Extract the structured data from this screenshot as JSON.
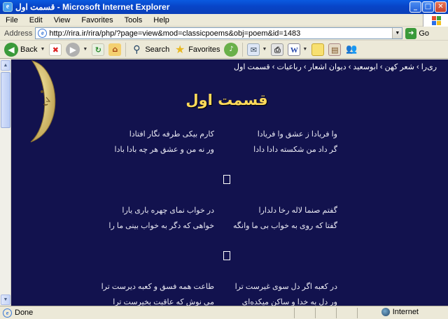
{
  "window": {
    "title": "قسمت اول - Microsoft Internet Explorer"
  },
  "menu": [
    "File",
    "Edit",
    "View",
    "Favorites",
    "Tools",
    "Help"
  ],
  "address": {
    "label": "Address",
    "url": "http://rira.ir/rira/php/?page=view&mod=classicpoems&obj=poem&id=1483",
    "go": "Go"
  },
  "toolbar": {
    "back": "Back",
    "search": "Search",
    "favorites": "Favorites"
  },
  "page": {
    "breadcrumb": "ری‌را › شعر کهن › ابوسعید › دیوان اشعار › رباعیات › قسمت اول",
    "title": "قسمت اول",
    "stanzas": [
      {
        "r1": "وا فریادا ز عشق وا فریادا",
        "l1": "کارم بیکی طرفه نگار افتادا",
        "r2": "گر داد من شکسته دادا دادا",
        "l2": "ور نه من و عشق هر چه بادا بادا"
      },
      {
        "r1": "گفتم صنما لاله رخا دلدارا",
        "l1": "در خواب نمای چهره باری یارا",
        "r2": "گفتا که روی به خواب بی ما وانگه",
        "l2": "خواهی که دگر به خواب بینی ما را"
      },
      {
        "r1": "در کعبه اگر دل سوی غیرست ترا",
        "l1": "طاعت همه فسق و کعبه دیرست ترا",
        "r2": "ور دل به خدا و ساکن میکده‌ای",
        "l2": "می نوش که عاقبت بخیرست ترا"
      }
    ]
  },
  "status": {
    "text": "Done",
    "zone": "Internet"
  },
  "colors": {
    "page_bg": "#12124e",
    "title": "#ffd95a",
    "text": "#e8e8f2"
  }
}
